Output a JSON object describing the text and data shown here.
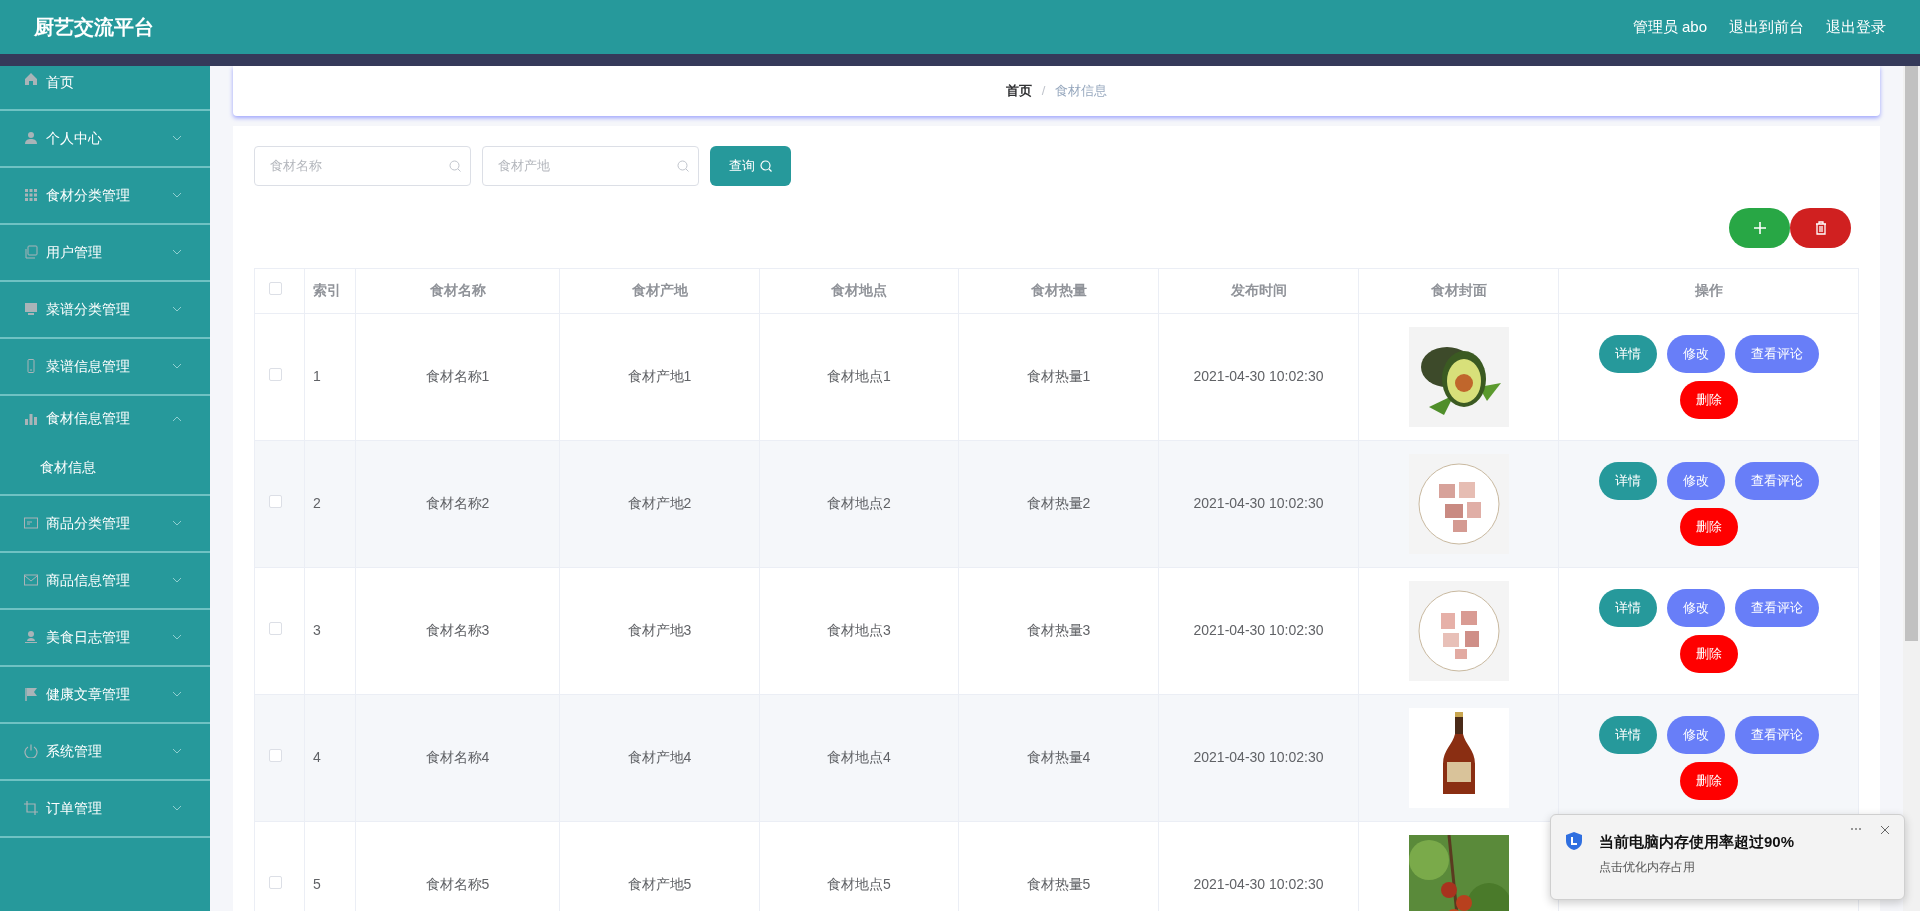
{
  "header": {
    "title": "厨艺交流平台",
    "links": [
      "管理员 abo",
      "退出到前台",
      "退出登录"
    ]
  },
  "sidebar": {
    "items": [
      {
        "label": "首页"
      },
      {
        "label": "个人中心",
        "expanded": false
      },
      {
        "label": "食材分类管理",
        "expanded": false
      },
      {
        "label": "用户管理",
        "expanded": false
      },
      {
        "label": "菜谱分类管理",
        "expanded": false
      },
      {
        "label": "菜谱信息管理",
        "expanded": false
      },
      {
        "label": "食材信息管理",
        "expanded": true,
        "children": [
          {
            "label": "食材信息"
          }
        ]
      },
      {
        "label": "商品分类管理",
        "expanded": false
      },
      {
        "label": "商品信息管理",
        "expanded": false
      },
      {
        "label": "美食日志管理",
        "expanded": false
      },
      {
        "label": "健康文章管理",
        "expanded": false
      },
      {
        "label": "系统管理",
        "expanded": false
      },
      {
        "label": "订单管理",
        "expanded": false
      }
    ]
  },
  "breadcrumb": [
    {
      "label": "首页",
      "current": false
    },
    {
      "separator": "/",
      "label": "食材信息",
      "current": true
    }
  ],
  "search": {
    "fields": [
      {
        "placeholder": "食材名称"
      },
      {
        "placeholder": "食材产地"
      }
    ],
    "button": "查询"
  },
  "table": {
    "header_checked": false,
    "columns": [
      "索引",
      "食材名称",
      "食材产地",
      "食材地点",
      "食材热量",
      "发布时间",
      "食材封面",
      "操作"
    ],
    "rows": [
      {
        "checked": false,
        "cells": [
          "1",
          "食材名称1",
          "食材产地1",
          "食材地点1",
          "食材热量1",
          "2021-04-30 10:02:30"
        ],
        "cover": {
          "kind": "picture"
        },
        "actions": [
          {
            "label": "详情",
            "kind": "detail"
          },
          {
            "label": "修改",
            "kind": "edit"
          },
          {
            "label": "查看评论",
            "kind": "edit"
          },
          {
            "label": "删除",
            "kind": "delete"
          }
        ]
      },
      {
        "checked": false,
        "cells": [
          "2",
          "食材名称2",
          "食材产地2",
          "食材地点2",
          "食材热量2",
          "2021-04-30 10:02:30"
        ],
        "cover": {
          "kind": "picture"
        },
        "actions": [
          {
            "label": "详情",
            "kind": "detail"
          },
          {
            "label": "修改",
            "kind": "edit"
          },
          {
            "label": "查看评论",
            "kind": "edit"
          },
          {
            "label": "删除",
            "kind": "delete"
          }
        ]
      },
      {
        "checked": false,
        "cells": [
          "3",
          "食材名称3",
          "食材产地3",
          "食材地点3",
          "食材热量3",
          "2021-04-30 10:02:30"
        ],
        "cover": {
          "kind": "picture"
        },
        "actions": [
          {
            "label": "详情",
            "kind": "detail"
          },
          {
            "label": "修改",
            "kind": "edit"
          },
          {
            "label": "查看评论",
            "kind": "edit"
          },
          {
            "label": "删除",
            "kind": "delete"
          }
        ]
      },
      {
        "checked": false,
        "cells": [
          "4",
          "食材名称4",
          "食材产地4",
          "食材地点4",
          "食材热量4",
          "2021-04-30 10:02:30"
        ],
        "cover": {
          "kind": "picture"
        },
        "actions": [
          {
            "label": "详情",
            "kind": "detail"
          },
          {
            "label": "修改",
            "kind": "edit"
          },
          {
            "label": "查看评论",
            "kind": "edit"
          },
          {
            "label": "删除",
            "kind": "delete"
          }
        ]
      },
      {
        "checked": false,
        "cells": [
          "5",
          "食材名称5",
          "食材产地5",
          "食材地点5",
          "食材热量5",
          "2021-04-30 10:02:30"
        ],
        "cover": {
          "kind": "picture"
        }
      }
    ]
  },
  "notification": {
    "title": "当前电脑内存使用率超过90%",
    "message": "点击优化内存占用"
  }
}
